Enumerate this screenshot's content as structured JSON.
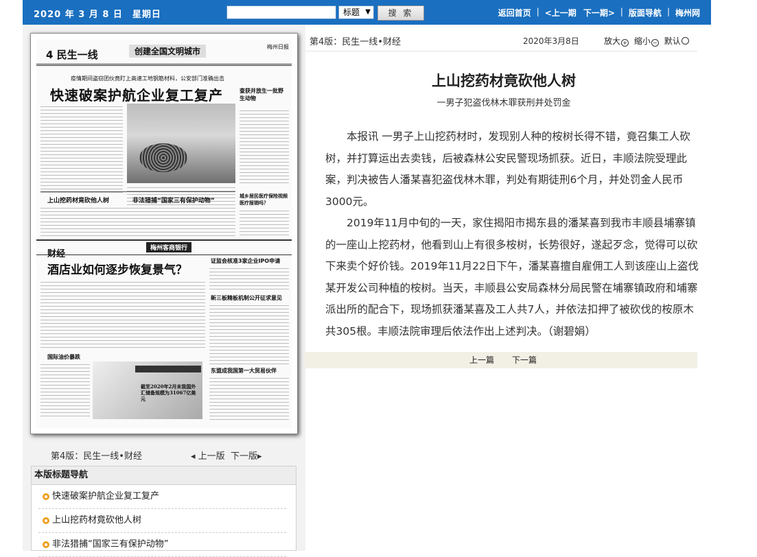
{
  "topbar": {
    "date": "2020 年 3 月 8 日　星期日",
    "search_placeholder": "",
    "select_value": "标题",
    "search_button": "搜 索",
    "nav": [
      "返回首页",
      "<上一期",
      "下一期>",
      "版面导航",
      "梅州网"
    ],
    "bg_color": "#1a6fc0"
  },
  "paper": {
    "page_no": "4 民生一线",
    "slogan": "创建全国文明城市",
    "brand": "梅州日报",
    "kicker": "疫情期间盗窃团伙竟盯上高速工地钢筋材料，公安部门准确出击",
    "headline": "快速破案护航企业复工复产",
    "sub1": "上山挖药材竟砍他人树",
    "sub2": "非法猎捕“国家三有保护动物”",
    "side1": "查获并放生一批野生动物",
    "side2": "城乡居民医疗保险视频医疗报销吗？",
    "band_label": "梅州客商银行",
    "sec2": "财经",
    "headline2": "酒店业如何逐步恢复景气？",
    "sub3": "证监会核准3家企业IPO申请",
    "sub4": "新三板精板机制公开征求意见",
    "sub5": "国际油价暴跌",
    "sub6": "东盟成我国第一大贸易伙伴",
    "chart_caption": "截至2020年2月末我国外汇储备规模为31067亿美元"
  },
  "left_footer": {
    "edition": "第4版：民生一线•财经",
    "prev": "上一版",
    "next": "下一版"
  },
  "nav_box": {
    "title": "本版标题导航",
    "items": [
      "快速破案护航企业复工复产",
      "上山挖药材竟砍他人树",
      "非法猎捕“国家三有保护动物”"
    ]
  },
  "meta": {
    "edition": "第4版：民生一线•财经",
    "date": "2020年3月8日",
    "zoom_in": "放大",
    "zoom_out": "缩小",
    "default": "默认"
  },
  "article": {
    "title": "上山挖药材竟砍他人树",
    "subtitle": "一男子犯盗伐林木罪获刑并处罚金",
    "paragraphs": [
      "本报讯 一男子上山挖药材时，发现别人种的桉树长得不错，竟召集工人砍树，并打算运出去卖钱，后被森林公安民警现场抓获。近日，丰顺法院受理此案，判决被告人潘某喜犯盗伐林木罪，判处有期徒刑6个月，并处罚金人民币3000元。",
      "2019年11月中旬的一天，家住揭阳市揭东县的潘某喜到我市丰顺县埔寨镇的一座山上挖药材，他看到山上有很多桉树，长势很好，遂起歹念，觉得可以砍下来卖个好价钱。2019年11月22日下午，潘某喜擅自雇佣工人到该座山上盗伐某开发公司种植的桉树。当天，丰顺县公安局森林分局民警在埔寨镇政府和埔寨派出所的配合下，现场抓获潘某喜及工人共7人，并依法扣押了被砍伐的桉原木共305根。丰顺法院审理后依法作出上述判决。（谢碧娟）"
    ],
    "prev": "上一篇",
    "next": "下一篇"
  }
}
